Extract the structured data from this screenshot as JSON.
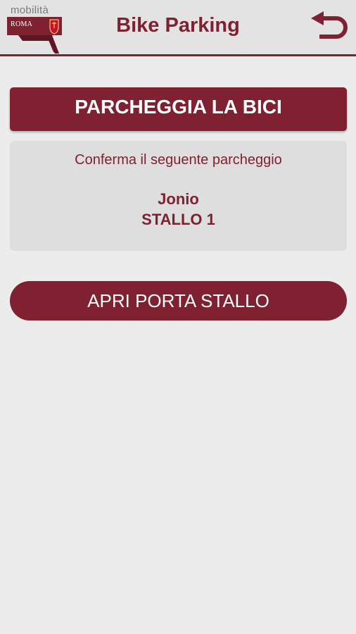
{
  "header": {
    "logo": {
      "word": "mobilità",
      "city": "ROMA"
    },
    "title": "Bike Parking",
    "back_icon": "undo-arrow-icon"
  },
  "main": {
    "section_title": "PARCHEGGIA LA BICI",
    "confirm": {
      "prompt": "Conferma il seguente parcheggio",
      "location": "Jonio",
      "stall": "STALLO 1"
    },
    "open_button_label": "APRI PORTA STALLO"
  },
  "colors": {
    "brand": "#7f2130",
    "background": "#ececec",
    "header_bg": "#e3e3e3",
    "card_bg": "#dedede"
  }
}
